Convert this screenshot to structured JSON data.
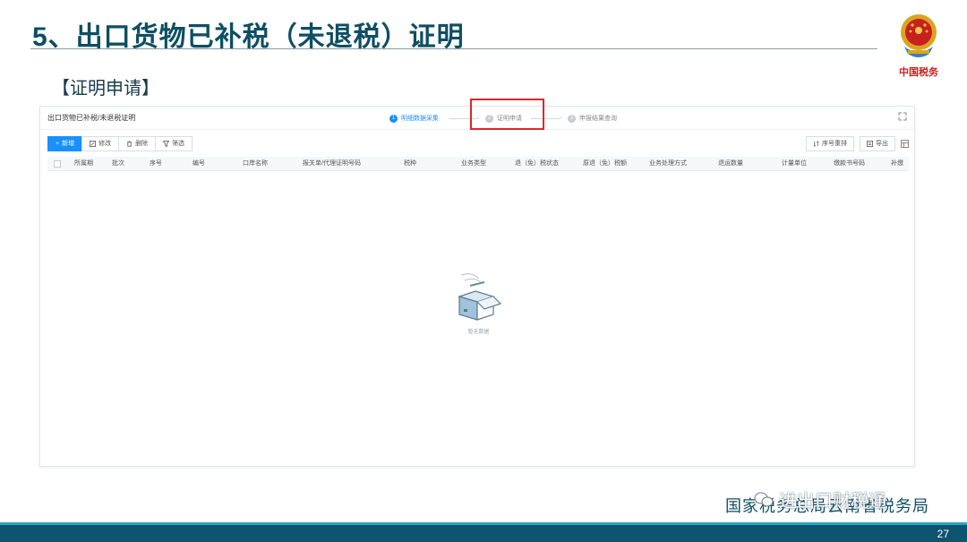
{
  "slide": {
    "title": "5、出口货物已补税（未退税）证明",
    "section_label": "【证明申请】",
    "footer_org": "国家税务总局云南省税务局",
    "watermark": "进出口财税通",
    "page_number": "27",
    "emblem_text": "中国税务"
  },
  "panel": {
    "breadcrumb": "出口货物已补税/未退税证明",
    "steps": [
      {
        "num": "1",
        "label": "明细数据采集",
        "active": true
      },
      {
        "num": "2",
        "label": "证明申请",
        "active": false
      },
      {
        "num": "3",
        "label": "申报结果查询",
        "active": false
      }
    ],
    "toolbar": {
      "add": "新增",
      "edit": "修改",
      "delete": "删除",
      "filter": "筛选",
      "reorder": "序号重排",
      "export": "导出"
    },
    "columns": [
      "所属期",
      "批次",
      "序号",
      "编号",
      "口岸名称",
      "报关单/代理证明号码",
      "税种",
      "业务类型",
      "退（免）税状态",
      "原退（免）税额",
      "业务处理方式",
      "退运数量",
      "计量单位",
      "缴款书号码",
      "补缴"
    ],
    "empty_text": "暂无数据"
  },
  "colors": {
    "title": "#0e4e63",
    "primary": "#1890ff",
    "highlight": "#e0262b",
    "bottom_bar": "#0e5470"
  }
}
